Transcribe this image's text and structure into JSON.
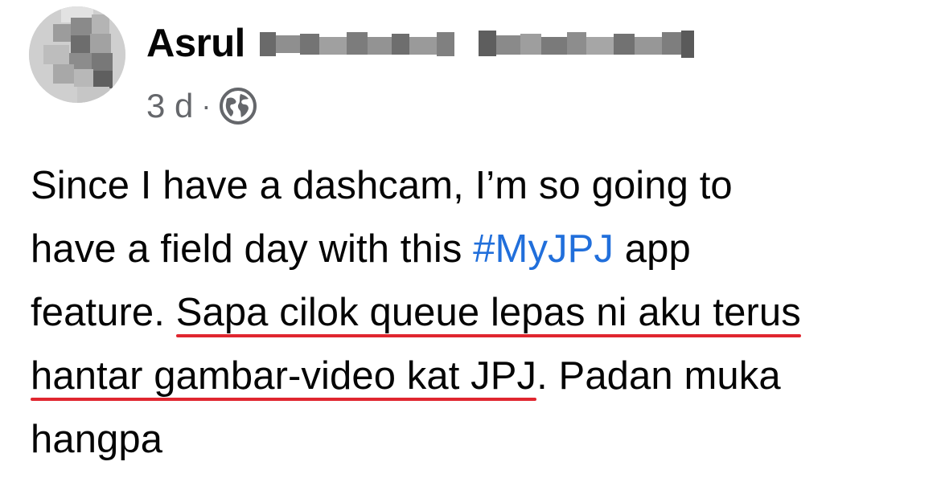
{
  "post": {
    "author": {
      "first_name": "Asrul"
    },
    "meta": {
      "time": "3 d",
      "separator": "·",
      "audience_icon": "globe-icon"
    },
    "message": {
      "line1": "Since I have a dashcam, I’m so going to",
      "line2_a": "have a field day with this ",
      "line2_hashtag": "#MyJPJ",
      "line2_b": " app",
      "line3_a": "feature. ",
      "line3_highlight": "Sapa cilok queue lepas ni aku terus",
      "line4_highlight": "hantar gambar-video kat JPJ",
      "line4_b": ". Padan muka",
      "line5": "hangpa"
    },
    "colors": {
      "text": "#050505",
      "meta": "#65676b",
      "hashtag": "#216fdb",
      "highlight_underline": "#e0262f"
    }
  }
}
